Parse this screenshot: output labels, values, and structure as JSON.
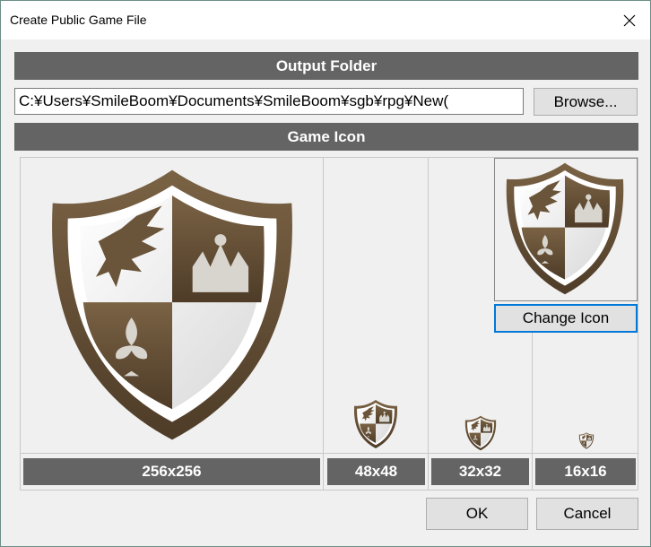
{
  "window": {
    "title": "Create Public Game File"
  },
  "output_folder": {
    "header": "Output Folder",
    "path_value": "C:¥Users¥SmileBoom¥Documents¥SmileBoom¥sgb¥rpg¥New(",
    "browse_label": "Browse..."
  },
  "game_icon": {
    "header": "Game Icon",
    "change_icon_label": "Change Icon",
    "sizes": [
      "256x256",
      "48x48",
      "32x32",
      "16x16"
    ]
  },
  "footer": {
    "ok_label": "OK",
    "cancel_label": "Cancel"
  },
  "colors": {
    "shield_brown": "#5e4a32",
    "header_gray": "#646464",
    "accent_blue": "#0078d7"
  },
  "icons": {
    "close": "close-icon",
    "game_icon": "shield-dragon-crown-icon"
  }
}
